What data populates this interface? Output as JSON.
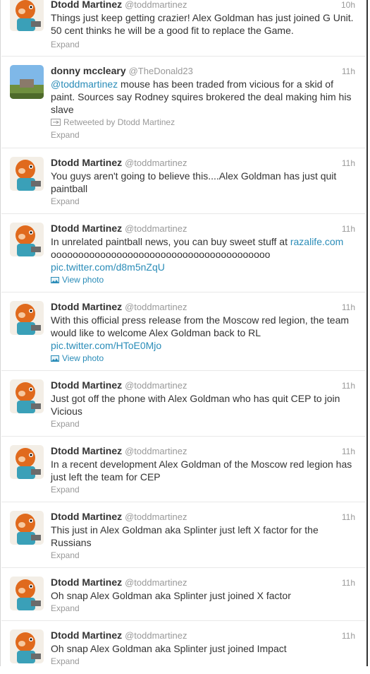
{
  "tweets": [
    {
      "name": "Dtodd Martinez",
      "handle": "@toddmartinez",
      "time": "10h",
      "text": "Things just keep getting crazier! Alex Goldman has just joined G Unit. 50 cent thinks he will be a good fit to replace the Game.",
      "expand": "Expand"
    },
    {
      "name": "donny mccleary",
      "handle": "@TheDonald23",
      "time": "11h",
      "mention": "@toddmartinez",
      "text": " mouse has been traded from vicious for a skid of paint. Sources say Rodney squires brokered the deal making him his slave",
      "retweeted": "Retweeted by Dtodd Martinez",
      "expand": "Expand"
    },
    {
      "name": "Dtodd Martinez",
      "handle": "@toddmartinez",
      "time": "11h",
      "text": "You guys aren't going to believe this....Alex Goldman has just quit paintball",
      "expand": "Expand"
    },
    {
      "name": "Dtodd Martinez",
      "handle": "@toddmartinez",
      "time": "11h",
      "text": "In unrelated paintball news, you can buy sweet stuff at ",
      "link1": "razalife.com",
      "text2": "oooooooooooooooooooooooooooooooooooooooo",
      "link2": "pic.twitter.com/d8m5nZqU",
      "view_photo": "View photo"
    },
    {
      "name": "Dtodd Martinez",
      "handle": "@toddmartinez",
      "time": "11h",
      "text": "With this official press release from the Moscow red legion, the team would like to welcome Alex Goldman back to RL",
      "link2": "pic.twitter.com/HToE0Mjo",
      "view_photo": "View photo"
    },
    {
      "name": "Dtodd Martinez",
      "handle": "@toddmartinez",
      "time": "11h",
      "text": "Just got off the phone with Alex Goldman who has quit CEP to join Vicious",
      "expand": "Expand"
    },
    {
      "name": "Dtodd Martinez",
      "handle": "@toddmartinez",
      "time": "11h",
      "text": "In a recent development Alex Goldman of the Moscow red legion has just left the team for CEP",
      "expand": "Expand"
    },
    {
      "name": "Dtodd Martinez",
      "handle": "@toddmartinez",
      "time": "11h",
      "text": "This just in Alex Goldman aka Splinter just left X factor for the Russians",
      "expand": "Expand"
    },
    {
      "name": "Dtodd Martinez",
      "handle": "@toddmartinez",
      "time": "11h",
      "text": "Oh snap Alex Goldman aka Splinter just joined X factor",
      "expand": "Expand"
    },
    {
      "name": "Dtodd Martinez",
      "handle": "@toddmartinez",
      "time": "11h",
      "text": "Oh snap Alex Goldman aka Splinter just joined Impact",
      "expand": "Expand"
    }
  ],
  "colors": {
    "link": "#2a8cb8",
    "muted": "#999999",
    "text": "#333333"
  }
}
